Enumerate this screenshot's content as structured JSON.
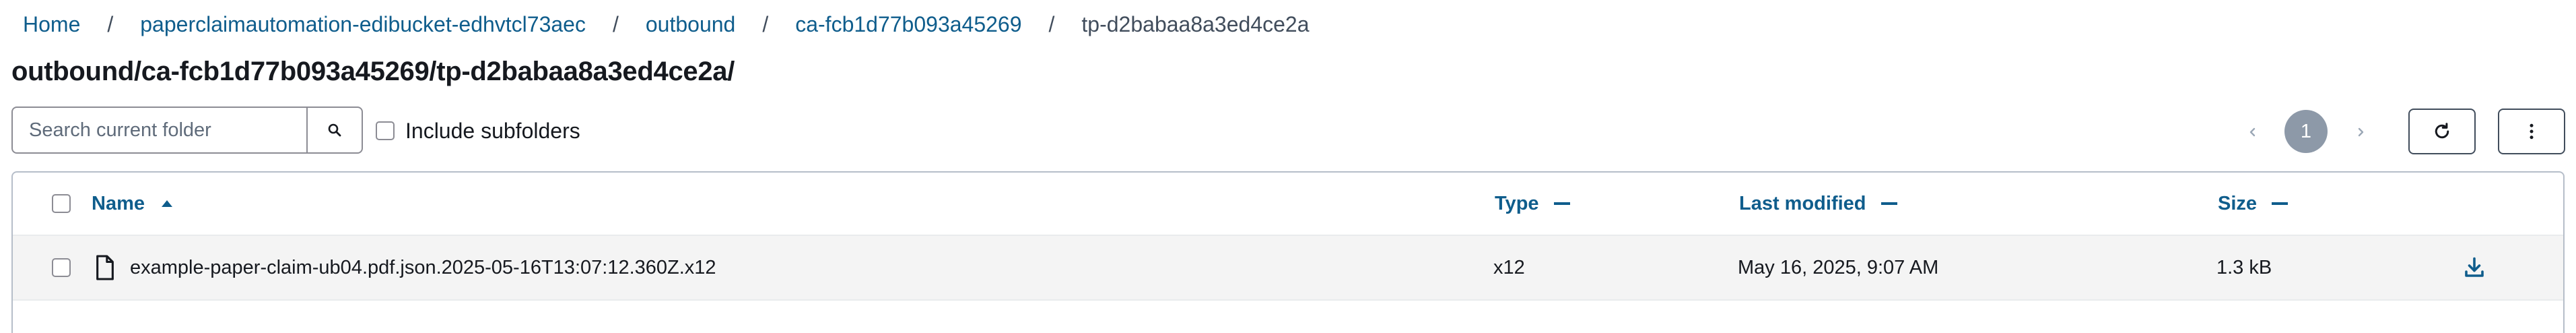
{
  "breadcrumb": {
    "items": [
      {
        "label": "Home"
      },
      {
        "label": "paperclaimautomation-edibucket-edhvtcl73aec"
      },
      {
        "label": "outbound"
      },
      {
        "label": "ca-fcb1d77b093a45269"
      }
    ],
    "separator": "/",
    "current": "tp-d2babaa8a3ed4ce2a"
  },
  "page_title": "outbound/ca-fcb1d77b093a45269/tp-d2babaa8a3ed4ce2a/",
  "search": {
    "placeholder": "Search current folder",
    "value": "",
    "icon": "search-icon"
  },
  "include_subfolders": {
    "label": "Include subfolders",
    "checked": false
  },
  "pagination": {
    "current_page": "1",
    "prev_icon": "chevron-left-icon",
    "next_icon": "chevron-right-icon"
  },
  "toolbar": {
    "refresh_icon": "refresh-icon",
    "more_icon": "more-vertical-icon"
  },
  "table": {
    "columns": [
      {
        "label": "Name",
        "sort": "ascending"
      },
      {
        "label": "Type",
        "sort": "none"
      },
      {
        "label": "Last modified",
        "sort": "none"
      },
      {
        "label": "Size",
        "sort": "none"
      }
    ],
    "rows": [
      {
        "name": "example-paper-claim-ub04.pdf.json.2025-05-16T13:07:12.360Z.x12",
        "type": "x12",
        "last_modified": "May 16, 2025, 9:07 AM",
        "size": "1.3 kB",
        "icon": "file-icon",
        "action_icon": "download-icon"
      }
    ]
  },
  "colors": {
    "link": "#0f5d8c",
    "text": "#16191f",
    "muted": "#414d5c",
    "border": "#8c8c94",
    "page_badge": "#8d99a8",
    "row_background": "#f4f4f4"
  }
}
